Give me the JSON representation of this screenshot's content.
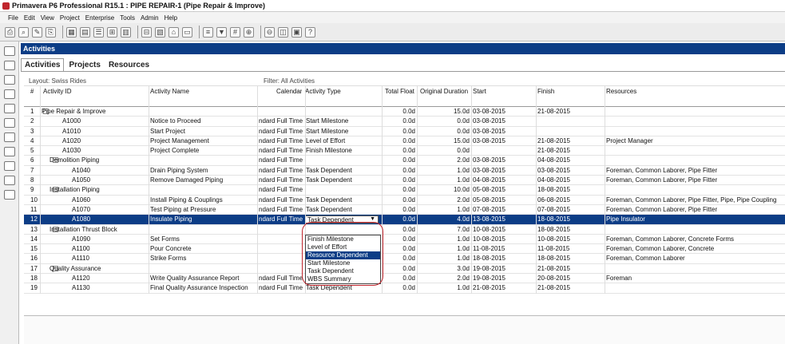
{
  "window": {
    "title": "Primavera P6 Professional R15.1 : PIPE REPAIR-1 (Pipe Repair & Improve)"
  },
  "menu": [
    "File",
    "Edit",
    "View",
    "Project",
    "Enterprise",
    "Tools",
    "Admin",
    "Help"
  ],
  "panel_title": "Activities",
  "tabs": [
    "Activities",
    "Projects",
    "Resources"
  ],
  "layout_label": "Layout: Swiss Rides",
  "filter_label": "Filter: All Activities",
  "columns": {
    "num": "#",
    "id": "Activity ID",
    "name": "Activity Name",
    "calendar": "Calendar",
    "type": "Activity Type",
    "float": "Total Float",
    "duration": "Original Duration",
    "start": "Start",
    "finish": "Finish",
    "resources": "Resources"
  },
  "rows": [
    {
      "n": "1",
      "level": 0,
      "id": "Pipe Repair & Improve",
      "name": "",
      "cal": "",
      "type": "",
      "float": "0.0d",
      "dur": "15.0d",
      "start": "03-08-2015",
      "finish": "21-08-2015",
      "res": ""
    },
    {
      "n": "2",
      "level": 2,
      "id": "A1000",
      "name": "Notice to Proceed",
      "cal": "ndard Full Time",
      "type": "Start Milestone",
      "float": "0.0d",
      "dur": "0.0d",
      "start": "03-08-2015",
      "finish": "",
      "res": ""
    },
    {
      "n": "3",
      "level": 2,
      "id": "A1010",
      "name": "Start Project",
      "cal": "ndard Full Time",
      "type": "Start Milestone",
      "float": "0.0d",
      "dur": "0.0d",
      "start": "03-08-2015",
      "finish": "",
      "res": ""
    },
    {
      "n": "4",
      "level": 2,
      "id": "A1020",
      "name": "Project Management",
      "cal": "ndard Full Time",
      "type": "Level of Effort",
      "float": "0.0d",
      "dur": "15.0d",
      "start": "03-08-2015",
      "finish": "21-08-2015",
      "res": "Project Manager"
    },
    {
      "n": "5",
      "level": 2,
      "id": "A1030",
      "name": "Project Complete",
      "cal": "ndard Full Time",
      "type": "Finish Milestone",
      "float": "0.0d",
      "dur": "0.0d",
      "start": "",
      "finish": "21-08-2015",
      "res": ""
    },
    {
      "n": "6",
      "level": 1,
      "id": "Demolition Piping",
      "name": "",
      "cal": "ndard Full Time",
      "type": "",
      "float": "0.0d",
      "dur": "2.0d",
      "start": "03-08-2015",
      "finish": "04-08-2015",
      "res": ""
    },
    {
      "n": "7",
      "level": 3,
      "id": "A1040",
      "name": "Drain Piping System",
      "cal": "ndard Full Time",
      "type": "Task Dependent",
      "float": "0.0d",
      "dur": "1.0d",
      "start": "03-08-2015",
      "finish": "03-08-2015",
      "res": "Foreman, Common Laborer, Pipe Fitter"
    },
    {
      "n": "8",
      "level": 3,
      "id": "A1050",
      "name": "Remove Damaged Piping",
      "cal": "ndard Full Time",
      "type": "Task Dependent",
      "float": "0.0d",
      "dur": "1.0d",
      "start": "04-08-2015",
      "finish": "04-08-2015",
      "res": "Foreman, Common Laborer, Pipe Fitter"
    },
    {
      "n": "9",
      "level": 1,
      "id": "Installation Piping",
      "name": "",
      "cal": "ndard Full Time",
      "type": "",
      "float": "0.0d",
      "dur": "10.0d",
      "start": "05-08-2015",
      "finish": "18-08-2015",
      "res": ""
    },
    {
      "n": "10",
      "level": 3,
      "id": "A1060",
      "name": "Install Piping & Couplings",
      "cal": "ndard Full Time",
      "type": "Task Dependent",
      "float": "0.0d",
      "dur": "2.0d",
      "start": "05-08-2015",
      "finish": "06-08-2015",
      "res": "Foreman, Common Laborer, Pipe Fitter, Pipe, Pipe Coupling"
    },
    {
      "n": "11",
      "level": 3,
      "id": "A1070",
      "name": "Test Piping at Pressure",
      "cal": "ndard Full Time",
      "type": "Task Dependent",
      "float": "0.0d",
      "dur": "1.0d",
      "start": "07-08-2015",
      "finish": "07-08-2015",
      "res": "Foreman, Common Laborer, Pipe Fitter"
    },
    {
      "n": "12",
      "level": 3,
      "id": "A1080",
      "name": "Insulate Piping",
      "cal": "ndard Full Time",
      "type": "Task Dependent",
      "float": "0.0d",
      "dur": "4.0d",
      "start": "13-08-2015",
      "finish": "18-08-2015",
      "res": "Pipe Insulator",
      "selected": true
    },
    {
      "n": "13",
      "level": 1,
      "id": "Installation Thrust Block",
      "name": "",
      "cal": "",
      "type": "",
      "float": "0.0d",
      "dur": "7.0d",
      "start": "10-08-2015",
      "finish": "18-08-2015",
      "res": ""
    },
    {
      "n": "14",
      "level": 3,
      "id": "A1090",
      "name": "Set Forms",
      "cal": "",
      "type": "",
      "float": "0.0d",
      "dur": "1.0d",
      "start": "10-08-2015",
      "finish": "10-08-2015",
      "res": "Foreman, Common Laborer, Concrete Forms"
    },
    {
      "n": "15",
      "level": 3,
      "id": "A1100",
      "name": "Pour Concrete",
      "cal": "",
      "type": "",
      "float": "0.0d",
      "dur": "1.0d",
      "start": "11-08-2015",
      "finish": "11-08-2015",
      "res": "Foreman, Common Laborer, Concrete"
    },
    {
      "n": "16",
      "level": 3,
      "id": "A1110",
      "name": "Strike Forms",
      "cal": "",
      "type": "",
      "float": "0.0d",
      "dur": "1.0d",
      "start": "18-08-2015",
      "finish": "18-08-2015",
      "res": "Foreman, Common Laborer"
    },
    {
      "n": "17",
      "level": 1,
      "id": "Quality Assurance",
      "name": "",
      "cal": "",
      "type": "",
      "float": "0.0d",
      "dur": "3.0d",
      "start": "19-08-2015",
      "finish": "21-08-2015",
      "res": ""
    },
    {
      "n": "18",
      "level": 3,
      "id": "A1120",
      "name": "Write Quality Assurance Report",
      "cal": "ndard Full Time",
      "type": "Task Dependent",
      "float": "0.0d",
      "dur": "2.0d",
      "start": "19-08-2015",
      "finish": "20-08-2015",
      "res": "Foreman"
    },
    {
      "n": "19",
      "level": 3,
      "id": "A1130",
      "name": "Final Quality Assurance Inspection",
      "cal": "ndard Full Time",
      "type": "Task Dependent",
      "float": "0.0d",
      "dur": "1.0d",
      "start": "21-08-2015",
      "finish": "21-08-2015",
      "res": ""
    }
  ],
  "dropdown": {
    "selected": "Task Dependent",
    "arrow": "▼",
    "options": [
      "Finish Milestone",
      "Level of Effort",
      "Resource Dependent",
      "Start Milestone",
      "Task Dependent",
      "WBS Summary"
    ],
    "highlighted_index": 2
  },
  "toolbar_glyphs": [
    "⎙",
    "⌕",
    "✎",
    "⎘",
    "▦",
    "▤",
    "☰",
    "⊞",
    "▥",
    "⊟",
    "▧",
    "⌂",
    "▭",
    "≡",
    "▼",
    "#",
    "⊕",
    "⊖",
    "◫",
    "▣",
    "?"
  ],
  "colors": {
    "header_bg": "#0c3d86",
    "selection": "#0c3d86",
    "annotation": "#c0262d"
  }
}
